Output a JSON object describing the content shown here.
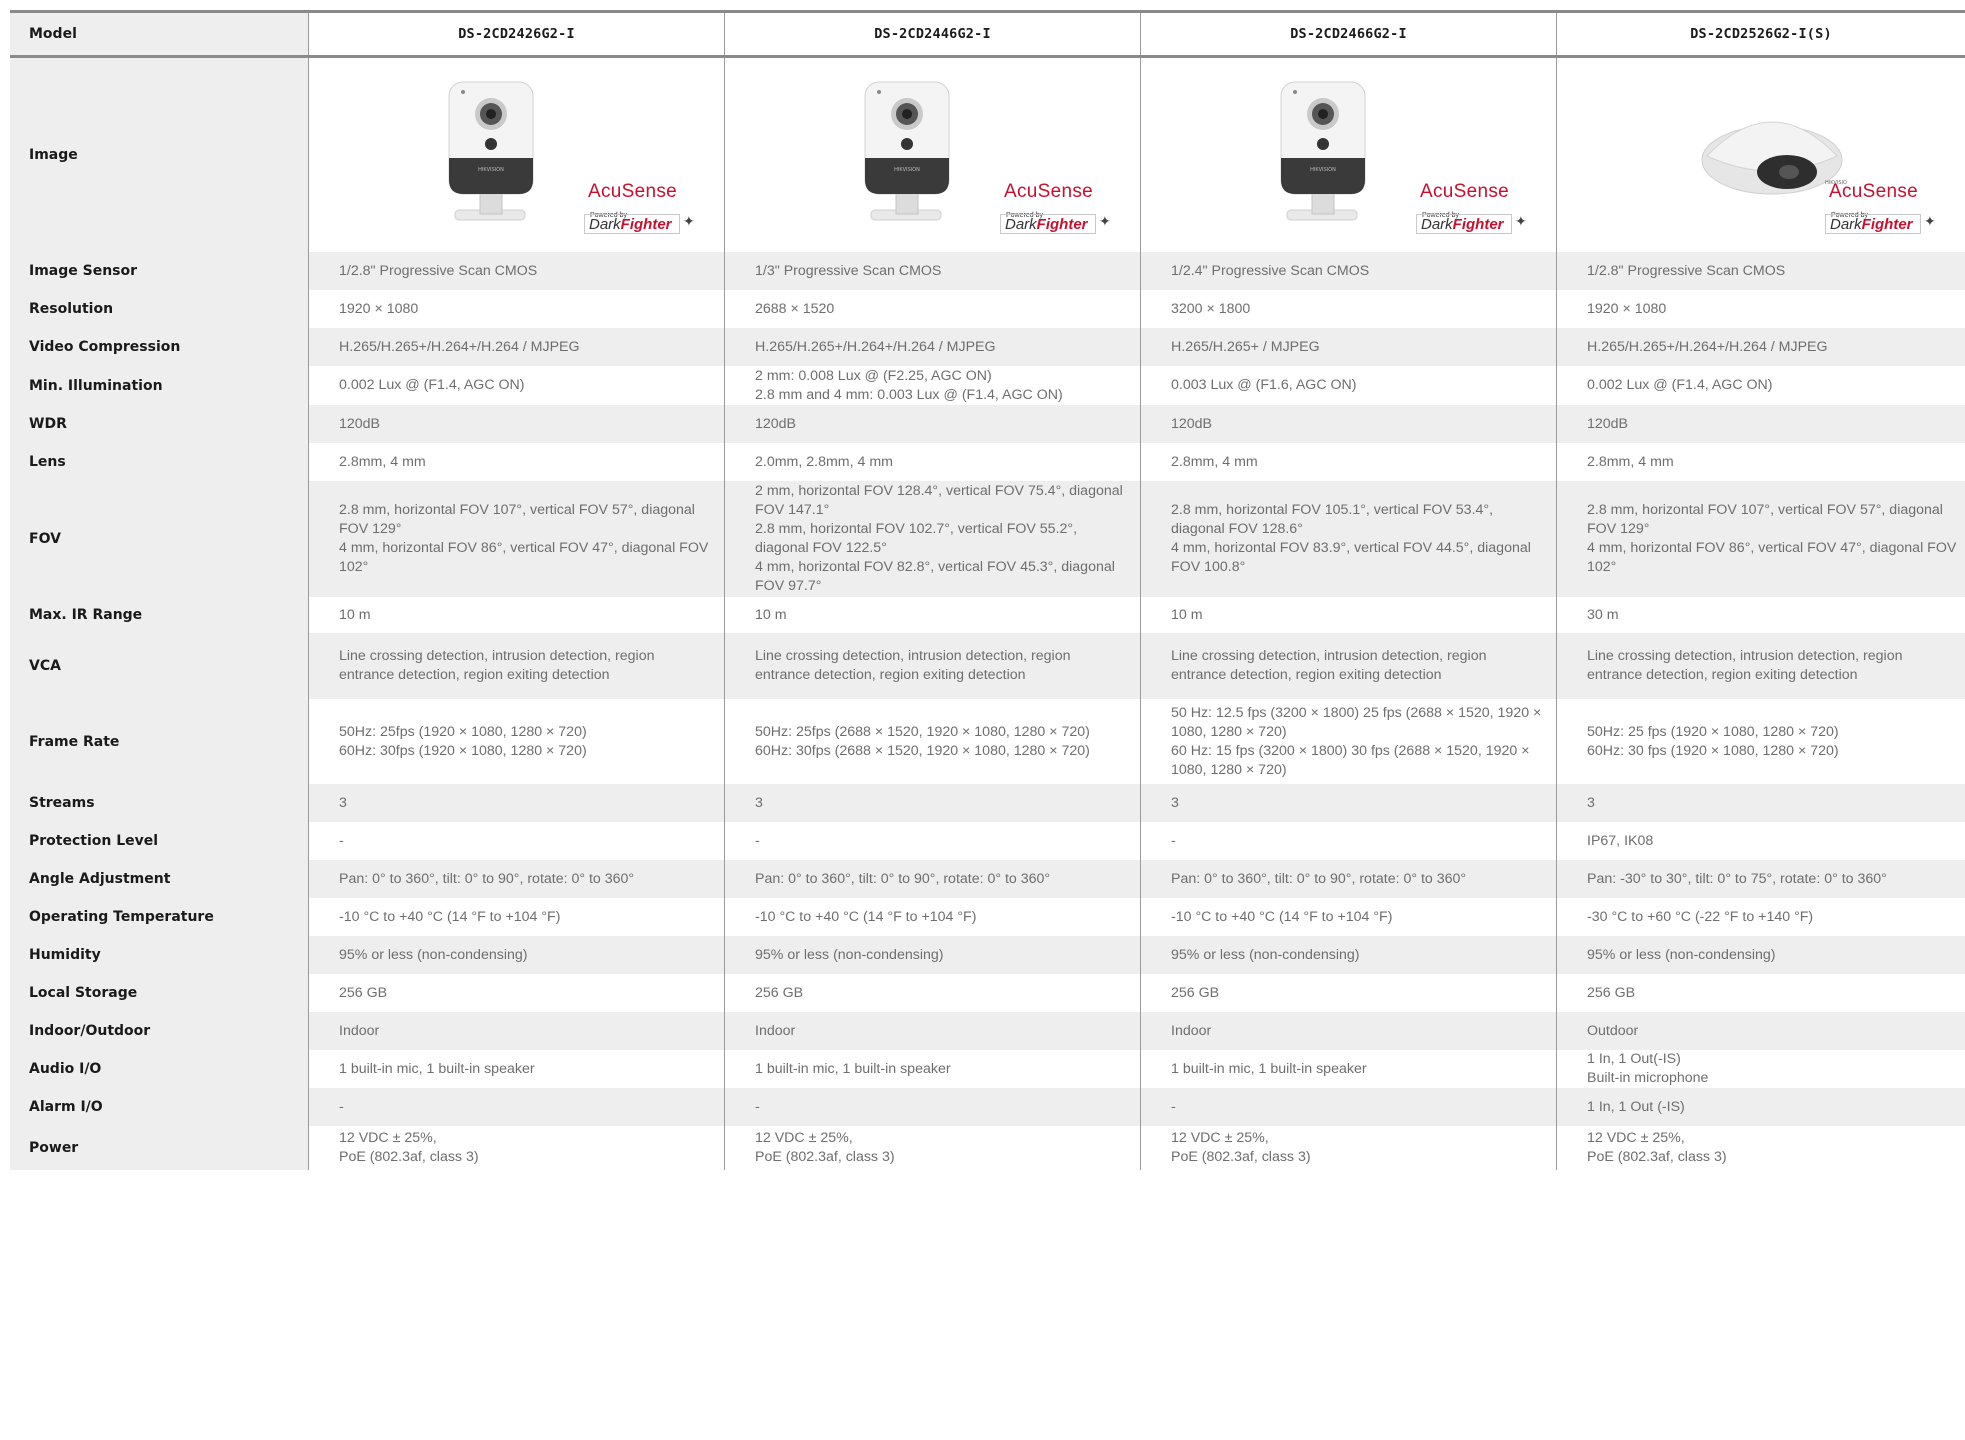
{
  "header": {
    "label": "Model",
    "models": [
      "DS-2CD2426G2-I",
      "DS-2CD2446G2-I",
      "DS-2CD2466G2-I",
      "DS-2CD2526G2-I(S)"
    ]
  },
  "image_row": {
    "label": "Image",
    "badge": {
      "acusense": "AcuSense",
      "powered_by": "Powered by",
      "dark": "Dark",
      "fighter": "Fighter"
    },
    "camera_types": [
      "cube-camera",
      "cube-camera",
      "cube-camera",
      "dome-camera"
    ]
  },
  "rows": [
    {
      "label": "Image Sensor",
      "values": [
        "1/2.8\" Progressive Scan CMOS",
        "1/3\" Progressive Scan CMOS",
        "1/2.4\" Progressive Scan CMOS",
        "1/2.8\" Progressive Scan CMOS"
      ]
    },
    {
      "label": "Resolution",
      "values": [
        "1920 × 1080",
        "2688 × 1520",
        "3200 × 1800",
        "1920 × 1080"
      ]
    },
    {
      "label": "Video Compression",
      "values": [
        "H.265/H.265+/H.264+/H.264 / MJPEG",
        "H.265/H.265+/H.264+/H.264 / MJPEG",
        "H.265/H.265+ / MJPEG",
        "H.265/H.265+/H.264+/H.264 / MJPEG"
      ]
    },
    {
      "label": "Min. Illumination",
      "values": [
        "0.002 Lux @ (F1.4, AGC ON)",
        "2 mm: 0.008 Lux @ (F2.25, AGC ON)\n2.8 mm and 4 mm:  0.003 Lux @ (F1.4, AGC ON)",
        "0.003 Lux @ (F1.6, AGC ON)",
        "0.002 Lux @ (F1.4, AGC ON)"
      ]
    },
    {
      "label": "WDR",
      "values": [
        "120dB",
        "120dB",
        "120dB",
        "120dB"
      ]
    },
    {
      "label": "Lens",
      "values": [
        "2.8mm, 4 mm",
        "2.0mm, 2.8mm, 4 mm",
        "2.8mm, 4 mm",
        "2.8mm, 4 mm"
      ]
    },
    {
      "label": "FOV",
      "values": [
        "2.8 mm, horizontal FOV 107°, vertical FOV 57°, diagonal FOV 129°\n4 mm, horizontal FOV 86°, vertical FOV 47°, diagonal FOV 102°",
        "2 mm, horizontal FOV 128.4°, vertical FOV 75.4°, diagonal FOV 147.1°\n2.8 mm, horizontal FOV 102.7°, vertical FOV 55.2°, diagonal FOV 122.5°\n4 mm, horizontal FOV 82.8°, vertical FOV 45.3°, diagonal FOV 97.7°",
        "2.8 mm, horizontal FOV 105.1°, vertical FOV 53.4°, diagonal FOV 128.6°\n4 mm, horizontal FOV 83.9°, vertical FOV 44.5°, diagonal FOV 100.8°",
        "2.8 mm, horizontal FOV 107°, vertical FOV 57°, diagonal FOV 129°\n4 mm, horizontal FOV 86°, vertical FOV 47°, diagonal FOV 102°"
      ]
    },
    {
      "label": "Max. IR Range",
      "values": [
        "10 m",
        "10 m",
        "10 m",
        "30 m"
      ]
    },
    {
      "label": "VCA",
      "values": [
        "Line crossing detection, intrusion detection, region entrance detection, region exiting detection",
        "Line crossing detection, intrusion detection, region entrance detection, region exiting detection",
        "Line crossing detection, intrusion detection, region entrance detection, region exiting detection",
        "Line crossing detection, intrusion detection, region entrance detection, region exiting detection"
      ]
    },
    {
      "label": "Frame Rate",
      "values": [
        "50Hz: 25fps (1920 × 1080, 1280 × 720)\n60Hz: 30fps (1920 × 1080, 1280 × 720)",
        "50Hz: 25fps (2688 × 1520, 1920 × 1080, 1280 × 720)\n60Hz: 30fps (2688 × 1520, 1920 × 1080, 1280 × 720)",
        "50 Hz: 12.5 fps (3200 × 1800) 25 fps (2688 × 1520, 1920 × 1080, 1280 × 720)\n 60 Hz: 15 fps (3200 × 1800)  30 fps (2688 × 1520, 1920 × 1080, 1280 × 720)",
        "50Hz: 25 fps (1920 × 1080, 1280 × 720)\n60Hz: 30 fps (1920 × 1080, 1280 × 720)"
      ]
    },
    {
      "label": "Streams",
      "values": [
        "3",
        "3",
        "3",
        "3"
      ]
    },
    {
      "label": "Protection Level",
      "values": [
        "-",
        "-",
        "-",
        "IP67, IK08"
      ]
    },
    {
      "label": "Angle Adjustment",
      "values": [
        "Pan: 0° to 360°, tilt: 0° to 90°, rotate: 0° to 360°",
        "Pan: 0° to 360°, tilt: 0° to 90°, rotate: 0° to 360°",
        "Pan: 0° to 360°, tilt: 0° to 90°, rotate: 0° to 360°",
        "Pan: -30° to 30°, tilt: 0° to 75°, rotate: 0° to 360°"
      ]
    },
    {
      "label": "Operating Temperature",
      "values": [
        "-10 °C to +40 °C (14 °F to +104 °F)",
        "-10 °C to +40 °C (14 °F to +104 °F)",
        "-10 °C to +40 °C (14 °F to +104 °F)",
        "-30 °C to +60 °C (-22 °F to +140 °F)"
      ]
    },
    {
      "label": "Humidity",
      "values": [
        "95% or less (non-condensing)",
        "95% or less (non-condensing)",
        "95% or less (non-condensing)",
        "95% or less (non-condensing)"
      ]
    },
    {
      "label": "Local Storage",
      "values": [
        "256 GB",
        "256 GB",
        "256 GB",
        "256 GB"
      ]
    },
    {
      "label": "Indoor/Outdoor",
      "values": [
        "Indoor",
        "Indoor",
        "Indoor",
        "Outdoor"
      ]
    },
    {
      "label": "Audio I/O",
      "values": [
        "1 built-in mic, 1 built-in speaker",
        "1 built-in mic, 1 built-in speaker",
        "1 built-in mic, 1 built-in speaker",
        "1 In, 1 Out(-IS)\nBuilt-in microphone"
      ]
    },
    {
      "label": "Alarm I/O",
      "values": [
        "-",
        "-",
        "-",
        "1 In, 1 Out (-IS)"
      ]
    },
    {
      "label": "Power",
      "values": [
        "12 VDC ± 25%,\nPoE (802.3af, class 3)",
        "12 VDC ± 25%,\nPoE (802.3af, class 3)",
        "12 VDC ± 25%,\nPoE (802.3af, class 3)",
        "12 VDC ± 25%,\nPoE (802.3af, class 3)"
      ]
    }
  ],
  "colors": {
    "shaded": "#eeeeee",
    "plain": "#ffffff",
    "rule": "#8a8a8a",
    "brand_red": "#c8102e"
  }
}
